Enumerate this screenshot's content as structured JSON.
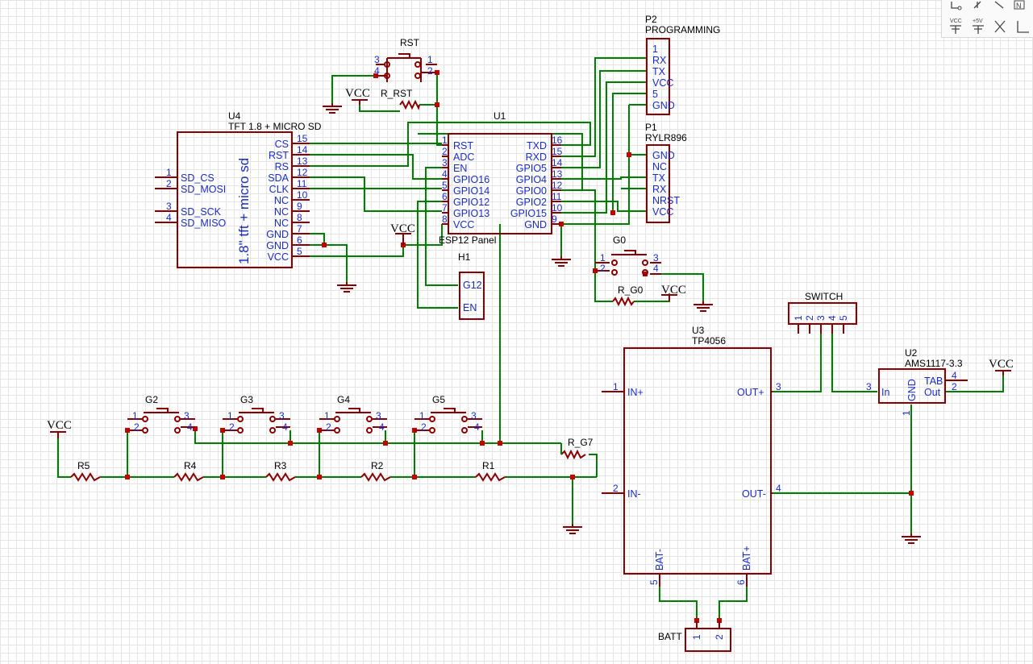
{
  "toolbar": {
    "vcc_label": "VCC",
    "plus5v_label": "+5V",
    "n_label": "N"
  },
  "vcc_label": "VCC",
  "u4": {
    "ref": "U4",
    "value": "TFT 1.8 + MICRO SD",
    "inner": "1.8\" tft + micro sd",
    "left_pins": [
      {
        "num": "1",
        "name": "SD_CS"
      },
      {
        "num": "2",
        "name": "SD_MOSI"
      },
      {
        "num": "3",
        "name": "SD_SCK"
      },
      {
        "num": "4",
        "name": "SD_MISO"
      }
    ],
    "right_pins": [
      {
        "num": "15",
        "name": "CS"
      },
      {
        "num": "14",
        "name": "RST"
      },
      {
        "num": "13",
        "name": "RS"
      },
      {
        "num": "12",
        "name": "SDA"
      },
      {
        "num": "11",
        "name": "CLK"
      },
      {
        "num": "10",
        "name": "NC"
      },
      {
        "num": "9",
        "name": "NC"
      },
      {
        "num": "8",
        "name": "NC"
      },
      {
        "num": "7",
        "name": "GND"
      },
      {
        "num": "6",
        "name": "GND"
      },
      {
        "num": "5",
        "name": "VCC"
      }
    ]
  },
  "u1": {
    "ref": "U1",
    "value": "ESP12 Panel",
    "left_pins": [
      {
        "num": "1",
        "name": "RST"
      },
      {
        "num": "2",
        "name": "ADC"
      },
      {
        "num": "3",
        "name": "EN"
      },
      {
        "num": "4",
        "name": "GPIO16"
      },
      {
        "num": "5",
        "name": "GPIO14"
      },
      {
        "num": "6",
        "name": "GPIO12"
      },
      {
        "num": "7",
        "name": "GPIO13"
      },
      {
        "num": "8",
        "name": "VCC"
      }
    ],
    "right_pins": [
      {
        "num": "16",
        "name": "TXD"
      },
      {
        "num": "15",
        "name": "RXD"
      },
      {
        "num": "14",
        "name": "GPIO5"
      },
      {
        "num": "13",
        "name": "GPIO4"
      },
      {
        "num": "12",
        "name": "GPIO0"
      },
      {
        "num": "11",
        "name": "GPIO2"
      },
      {
        "num": "10",
        "name": "GPIO15"
      },
      {
        "num": "9",
        "name": "GND"
      }
    ]
  },
  "p2": {
    "ref": "P2",
    "value": "PROGRAMMING",
    "pins": [
      "1",
      "RX",
      "TX",
      "VCC",
      "5",
      "GND"
    ]
  },
  "p1": {
    "ref": "P1",
    "value": "RYLR896",
    "pins": [
      "GND",
      "NC",
      "TX",
      "RX",
      "NRST",
      "VCC"
    ]
  },
  "h1": {
    "ref": "H1",
    "pins": [
      "G12",
      "EN"
    ]
  },
  "rst": {
    "ref": "RST",
    "pins": [
      "3",
      "4",
      "1",
      "2"
    ]
  },
  "g0": {
    "ref": "G0",
    "pins": [
      "1",
      "2",
      "3",
      "4"
    ]
  },
  "buttons": [
    {
      "ref": "G2"
    },
    {
      "ref": "G3"
    },
    {
      "ref": "G4"
    },
    {
      "ref": "G5"
    }
  ],
  "button_pins": [
    "1",
    "2",
    "3",
    "4"
  ],
  "resistors": {
    "r_rst": "R_RST",
    "r_g0": "R_G0",
    "r_g7": "R_G7",
    "r5": "R5",
    "r4": "R4",
    "r3": "R3",
    "r2": "R2",
    "r1": "R1"
  },
  "u3": {
    "ref": "U3",
    "value": "TP4056",
    "pins": [
      {
        "num": "1",
        "name": "IN+"
      },
      {
        "num": "2",
        "name": "IN-"
      },
      {
        "num": "3",
        "name": "OUT+"
      },
      {
        "num": "4",
        "name": "OUT-"
      },
      {
        "num": "5",
        "name": "BAT-"
      },
      {
        "num": "6",
        "name": "BAT+"
      }
    ]
  },
  "u2": {
    "ref": "U2",
    "value": "AMS1117-3.3",
    "pins": [
      {
        "num": "3",
        "name": "In"
      },
      {
        "num": "1",
        "name": "GND"
      },
      {
        "num": "4",
        "name": "TAB"
      },
      {
        "num": "2",
        "name": "Out"
      }
    ]
  },
  "switch": {
    "ref": "SWITCH",
    "pins": [
      "1",
      "2",
      "3",
      "4",
      "5"
    ]
  },
  "batt": {
    "ref": "BATT",
    "pins": [
      "1",
      "2"
    ]
  }
}
